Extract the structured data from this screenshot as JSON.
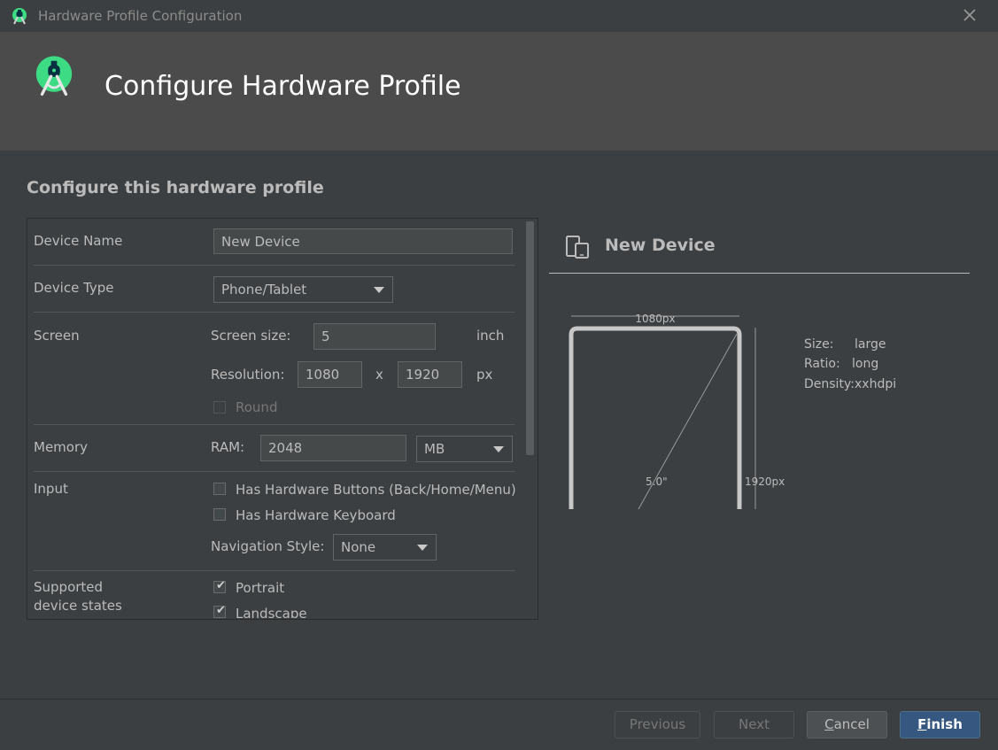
{
  "window": {
    "title": "Hardware Profile Configuration"
  },
  "header": {
    "title": "Configure Hardware Profile"
  },
  "form": {
    "section_title": "Configure this hardware profile",
    "device_name": {
      "label": "Device Name",
      "value": "New Device"
    },
    "device_type": {
      "label": "Device Type",
      "value": "Phone/Tablet"
    },
    "screen": {
      "label": "Screen",
      "size_label": "Screen size:",
      "size_value": "5",
      "size_unit": "inch",
      "resolution_label": "Resolution:",
      "res_width": "1080",
      "res_x": "x",
      "res_height": "1920",
      "res_unit": "px",
      "round_label": "Round"
    },
    "memory": {
      "label": "Memory",
      "ram_label": "RAM:",
      "ram_value": "2048",
      "ram_unit": "MB"
    },
    "input": {
      "label": "Input",
      "hw_buttons_label": "Has Hardware Buttons (Back/Home/Menu)",
      "hw_keyboard_label": "Has Hardware Keyboard",
      "nav_style_label": "Navigation Style:",
      "nav_style_value": "None"
    },
    "states": {
      "label_line1": "Supported",
      "label_line2": "device states",
      "portrait_label": "Portrait",
      "landscape_label": "Landscape"
    }
  },
  "preview": {
    "title": "New Device",
    "width_label": "1080px",
    "height_label": "1920px",
    "diagonal_label": "5.0\"",
    "size_key": "Size:",
    "size_value": "large",
    "ratio_key": "Ratio:",
    "ratio_value": "long",
    "density_key": "Density:",
    "density_value": "xxhdpi"
  },
  "footer": {
    "previous": "Previous",
    "next": "Next",
    "cancel_mn": "C",
    "cancel_rest": "ancel",
    "finish_mn": "F",
    "finish_rest": "inish"
  },
  "icons": {
    "app": "android-studio-icon",
    "close": "close-icon",
    "device": "phone-tablet-icon"
  },
  "colors": {
    "accent": "#365880",
    "logo_green": "#3ddc84",
    "header_bg": "#4b4b4b"
  }
}
